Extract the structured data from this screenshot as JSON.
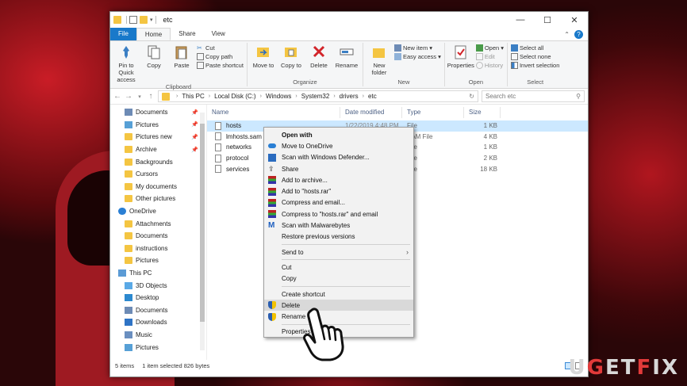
{
  "window": {
    "title": "etc",
    "controls": [
      "—",
      "☐",
      "✕"
    ]
  },
  "tabs": {
    "file": "File",
    "home": "Home",
    "share": "Share",
    "view": "View"
  },
  "ribbon": {
    "clipboard": {
      "label": "Clipboard",
      "pin": "Pin to Quick access",
      "copy": "Copy",
      "paste": "Paste",
      "cut": "Cut",
      "copy_path": "Copy path",
      "paste_shortcut": "Paste shortcut"
    },
    "organize": {
      "label": "Organize",
      "move_to": "Move to",
      "copy_to": "Copy to",
      "delete": "Delete",
      "rename": "Rename"
    },
    "new": {
      "label": "New",
      "new_folder": "New folder",
      "new_item": "New item",
      "easy_access": "Easy access"
    },
    "open": {
      "label": "Open",
      "properties": "Properties",
      "open": "Open",
      "edit": "Edit",
      "history": "History"
    },
    "select": {
      "label": "Select",
      "select_all": "Select all",
      "select_none": "Select none",
      "invert": "Invert selection"
    }
  },
  "address": {
    "crumbs": [
      "This PC",
      "Local Disk (C:)",
      "Windows",
      "System32",
      "drivers",
      "etc"
    ],
    "search_placeholder": "Search etc"
  },
  "nav": [
    {
      "label": "Documents",
      "icon": "doc",
      "pinned": true
    },
    {
      "label": "Pictures",
      "icon": "pic",
      "pinned": true
    },
    {
      "label": "Pictures new",
      "icon": "folder",
      "pinned": true
    },
    {
      "label": "Archive",
      "icon": "folder",
      "pinned": true
    },
    {
      "label": "Backgrounds",
      "icon": "folder"
    },
    {
      "label": "Cursors",
      "icon": "folder"
    },
    {
      "label": "My documents",
      "icon": "folder"
    },
    {
      "label": "Other pictures",
      "icon": "folder"
    },
    {
      "label": "OneDrive",
      "icon": "cloud",
      "top": true
    },
    {
      "label": "Attachments",
      "icon": "folder"
    },
    {
      "label": "Documents",
      "icon": "folder"
    },
    {
      "label": "instructions",
      "icon": "folder"
    },
    {
      "label": "Pictures",
      "icon": "folder"
    },
    {
      "label": "This PC",
      "icon": "pc",
      "top": true
    },
    {
      "label": "3D Objects",
      "icon": "3d"
    },
    {
      "label": "Desktop",
      "icon": "desk"
    },
    {
      "label": "Documents",
      "icon": "doc"
    },
    {
      "label": "Downloads",
      "icon": "dl"
    },
    {
      "label": "Music",
      "icon": "music"
    },
    {
      "label": "Pictures",
      "icon": "pic"
    }
  ],
  "columns": {
    "name": "Name",
    "date": "Date modified",
    "type": "Type",
    "size": "Size"
  },
  "files": [
    {
      "name": "hosts",
      "date": "1/22/2019 4:48 PM",
      "type": "File",
      "size": "1 KB",
      "selected": true
    },
    {
      "name": "lmhosts.sam",
      "date": "",
      "type": "SAM File",
      "size": "4 KB"
    },
    {
      "name": "networks",
      "date": "",
      "type": "File",
      "size": "1 KB"
    },
    {
      "name": "protocol",
      "date": "",
      "type": "File",
      "size": "2 KB"
    },
    {
      "name": "services",
      "date": "",
      "type": "File",
      "size": "18 KB"
    }
  ],
  "status": {
    "items": "5 items",
    "selected": "1 item selected  826 bytes"
  },
  "context_menu": {
    "open_with": "Open with",
    "move_onedrive": "Move to OneDrive",
    "defender": "Scan with Windows Defender...",
    "share": "Share",
    "add_archive": "Add to archive...",
    "add_rar": "Add to \"hosts.rar\"",
    "compress_email": "Compress and email...",
    "compress_rar_email": "Compress to \"hosts.rar\" and email",
    "malwarebytes": "Scan with Malwarebytes",
    "restore": "Restore previous versions",
    "send_to": "Send to",
    "cut": "Cut",
    "copy": "Copy",
    "create_shortcut": "Create shortcut",
    "delete": "Delete",
    "rename": "Rename",
    "properties": "Properties"
  },
  "logo": {
    "pre": "U",
    "accent": "G",
    "mid": "ET",
    "accent2": "F",
    "post": "IX"
  }
}
